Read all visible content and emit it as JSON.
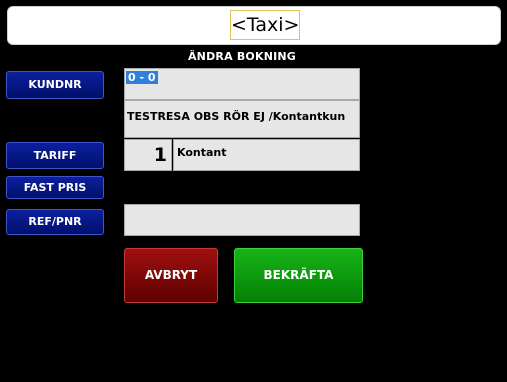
{
  "header": {
    "title": "<Taxi>"
  },
  "form": {
    "heading": "ÄNDRA BOKNING",
    "kundnr": {
      "label": "KUNDNR",
      "value": "0 - 0",
      "description": "TESTRESA OBS RÖR EJ /Kontantkun"
    },
    "tariff": {
      "label": "TARIFF",
      "number": "1",
      "name": "Kontant"
    },
    "fast_pris": {
      "label": "FAST PRIS"
    },
    "ref_pnr": {
      "label": "REF/PNR",
      "value": ""
    }
  },
  "actions": {
    "cancel_label": "AVBRYT",
    "confirm_label": "BEKRÄFTA"
  },
  "colors": {
    "background": "#000000",
    "side_button": "#0b1a8c",
    "cancel": "#8a0000",
    "confirm": "#0f9d0f",
    "selection": "#2f7fdc"
  }
}
